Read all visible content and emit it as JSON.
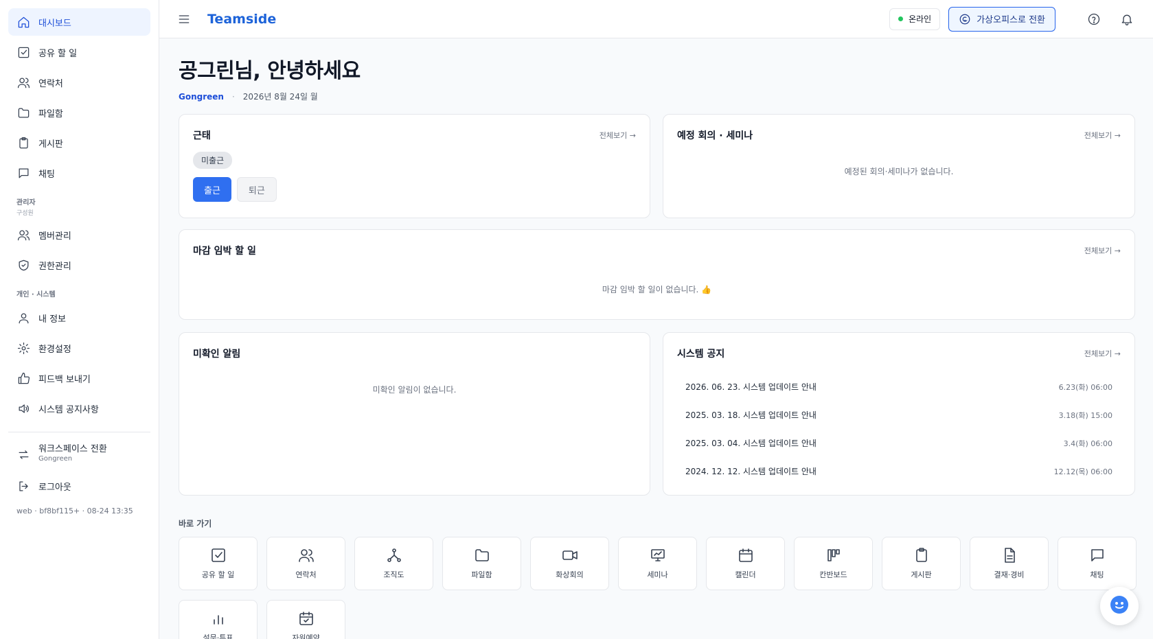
{
  "sidebar": {
    "items": [
      {
        "label": "대시보드",
        "icon": "home-icon"
      },
      {
        "label": "공유 할 일",
        "icon": "checkbox-icon"
      },
      {
        "label": "연락처",
        "icon": "users-icon"
      },
      {
        "label": "파일함",
        "icon": "folder-icon"
      },
      {
        "label": "게시판",
        "icon": "clipboard-icon"
      },
      {
        "label": "채팅",
        "icon": "chat-icon"
      }
    ],
    "admin_label": "관리자",
    "admin_sub": "구성원",
    "admin_items": [
      {
        "label": "멤버관리",
        "icon": "users-icon"
      },
      {
        "label": "권한관리",
        "icon": "shield-icon"
      }
    ],
    "personal_label": "개인 · 시스템",
    "personal_items": [
      {
        "label": "내 정보",
        "icon": "user-icon"
      },
      {
        "label": "환경설정",
        "icon": "gear-icon"
      },
      {
        "label": "피드백 보내기",
        "icon": "thumbs-up-icon"
      },
      {
        "label": "시스템 공지사항",
        "icon": "speaker-icon"
      }
    ],
    "workspace_switch": {
      "label": "워크스페이스 전환",
      "sub": "Gongreen"
    },
    "logout": "로그아웃",
    "build_info": "web · bf8bf115+ · 08-24 13:35"
  },
  "topbar": {
    "brand": "Teamside",
    "status": "온라인",
    "virtual_office_button": "가상오피스로 전환"
  },
  "header": {
    "greeting": "공그린님, 안녕하세요",
    "workspace": "Gongreen",
    "separator": "·",
    "date": "2026년 8월 24일 월"
  },
  "cards": {
    "attendance": {
      "title": "근태",
      "see_all": "전체보기 →",
      "status_badge": "미출근",
      "clock_in": "출근",
      "clock_out": "퇴근"
    },
    "meetings": {
      "title": "예정 회의 · 세미나",
      "see_all": "전체보기 →",
      "empty": "예정된 회의·세미나가 없습니다."
    },
    "deadline": {
      "title": "마감 임박 할 일",
      "see_all": "전체보기 →",
      "empty": "마감 임박 할 일이 없습니다. 👍"
    },
    "unread": {
      "title": "미확인 알림",
      "empty": "미확인 알림이 없습니다."
    },
    "notices": {
      "title": "시스템 공지",
      "see_all": "전체보기 →",
      "rows": [
        {
          "title": "2026. 06. 23. 시스템 업데이트 안내",
          "time": "6.23(화) 06:00"
        },
        {
          "title": "2025. 03. 18. 시스템 업데이트 안내",
          "time": "3.18(화) 15:00"
        },
        {
          "title": "2025. 03. 04. 시스템 업데이트 안내",
          "time": "3.4(화) 06:00"
        },
        {
          "title": "2024. 12. 12. 시스템 업데이트 안내",
          "time": "12.12(목) 06:00"
        }
      ]
    }
  },
  "shortcuts": {
    "label": "바로 가기",
    "items": [
      {
        "label": "공유 할 일",
        "icon": "checkbox-icon"
      },
      {
        "label": "연락처",
        "icon": "users-icon"
      },
      {
        "label": "조직도",
        "icon": "org-chart-icon"
      },
      {
        "label": "파일함",
        "icon": "folder-icon"
      },
      {
        "label": "화상회의",
        "icon": "video-icon"
      },
      {
        "label": "세미나",
        "icon": "presentation-icon"
      },
      {
        "label": "캘린더",
        "icon": "calendar-icon"
      },
      {
        "label": "칸반보드",
        "icon": "kanban-icon"
      },
      {
        "label": "게시판",
        "icon": "clipboard-icon"
      },
      {
        "label": "결재·경비",
        "icon": "document-icon"
      },
      {
        "label": "채팅",
        "icon": "chat-icon"
      },
      {
        "label": "설문·투표",
        "icon": "bar-chart-icon"
      },
      {
        "label": "자원예약",
        "icon": "calendar-check-icon"
      }
    ]
  },
  "colors": {
    "accent": "#2f6ff0",
    "brand": "#1d63d9",
    "online": "#22c55e"
  }
}
